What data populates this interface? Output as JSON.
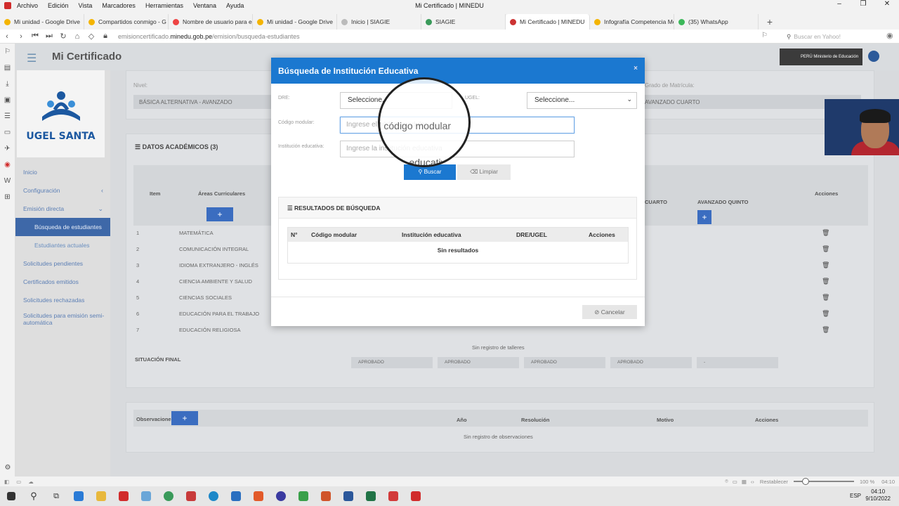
{
  "browser": {
    "menus": [
      "Archivo",
      "Edición",
      "Vista",
      "Marcadores",
      "Herramientas",
      "Ventana",
      "Ayuda"
    ],
    "window_title": "Mi Certificado | MINEDU",
    "tabs": [
      {
        "label": "Mi unidad - Google Drive",
        "color": "#f4b400"
      },
      {
        "label": "Compartidos conmigo - G",
        "color": "#f4b400"
      },
      {
        "label": "Nombre de usuario para el",
        "color": "#e44"
      },
      {
        "label": "Mi unidad - Google Drive",
        "color": "#f4b400"
      },
      {
        "label": "Inicio | SIAGIE",
        "color": "#aaa"
      },
      {
        "label": "SIAGIE",
        "color": "#3a9a5a"
      },
      {
        "label": "Mi Certificado | MINEDU",
        "color": "#c33"
      },
      {
        "label": "Infografía Competencia Mo",
        "color": "#f4b400"
      },
      {
        "label": "(35) WhatsApp",
        "color": "#3cb85a"
      }
    ],
    "url_prefix": "emisioncertificado.",
    "url_host": "minedu.gob.pe",
    "url_path": "/emision/busqueda-estudiantes",
    "search_placeholder": "Buscar en Yahoo!"
  },
  "app": {
    "title": "Mi Certificado",
    "logo_text": "UGEL SANTA",
    "peru_text": "PERÚ  Ministerio de Educación",
    "nav": [
      {
        "label": "Inicio"
      },
      {
        "label": "Configuración",
        "chev": "‹"
      },
      {
        "label": "Emisión directa",
        "chev": "⌄"
      },
      {
        "label": "Búsqueda de estudiantes"
      },
      {
        "label": "Estudiantes actuales"
      },
      {
        "label": "Solicitudes pendientes"
      },
      {
        "label": "Certificados emitidos"
      },
      {
        "label": "Solicitudes rechazadas"
      },
      {
        "label": "Solicitudes para emisión semi-automática"
      }
    ]
  },
  "background": {
    "nivel_label": "Nivel:",
    "nivel_value": "BÁSICA ALTERNATIVA - AVANZADO",
    "grado_label": "Grado de Matrícula:",
    "grado_value": "AVANZADO CUARTO",
    "datos_title": "DATOS ACADÉMICOS (3)",
    "col_item": "Item",
    "col_areas": "Áreas Curriculares",
    "col_cuarto": "CUARTO",
    "col_quinto": "AVANZADO QUINTO",
    "col_acciones": "Acciones",
    "plus": "+",
    "subjects": [
      "MATEMÁTICA",
      "COMUNICACIÓN INTEGRAL",
      "IDIOMA EXTRANJERO - INGLÉS",
      "CIENCIA AMBIENTE Y SALUD",
      "CIENCIAS SOCIALES",
      "EDUCACIÓN PARA EL TRABAJO",
      "EDUCACIÓN RELIGIOSA"
    ],
    "sin_talleres": "Sin registro de talleres",
    "situacion": "SITUACIÓN FINAL",
    "aprobado": "APROBADO",
    "dash": "-",
    "obs_label": "Observaciones",
    "obs_cols": [
      "Año",
      "Resolución",
      "Motivo",
      "Acciones"
    ],
    "sin_obs": "Sin registro de observaciones"
  },
  "modal": {
    "title": "Búsqueda de Institución Educativa",
    "close": "×",
    "dre_label": "DRE:",
    "dre_value": "Seleccione...",
    "ugel_label": "UGEL:",
    "ugel_value": "Seleccione...",
    "codigo_label": "Código modular:",
    "codigo_placeholder": "Ingrese el código modular",
    "inst_label": "Institución educativa:",
    "inst_placeholder": "Ingrese la institución educativa",
    "buscar": "Buscar",
    "limpiar": "Limpiar",
    "results_title": "RESULTADOS DE BÚSQUEDA",
    "cols": [
      "N°",
      "Código modular",
      "Institución educativa",
      "DRE/UGEL",
      "Acciones"
    ],
    "no_results": "Sin resultados",
    "cancelar": "Cancelar",
    "mag_text1": "Ingrese el código modular",
    "mag_text2": "ón educativa"
  },
  "statusbar": {
    "reset": "Restablecer",
    "zoom": "100 %",
    "time": "04:10"
  },
  "taskbar": {
    "lang": "ESP",
    "time": "04:10",
    "date": "9/10/2022"
  }
}
